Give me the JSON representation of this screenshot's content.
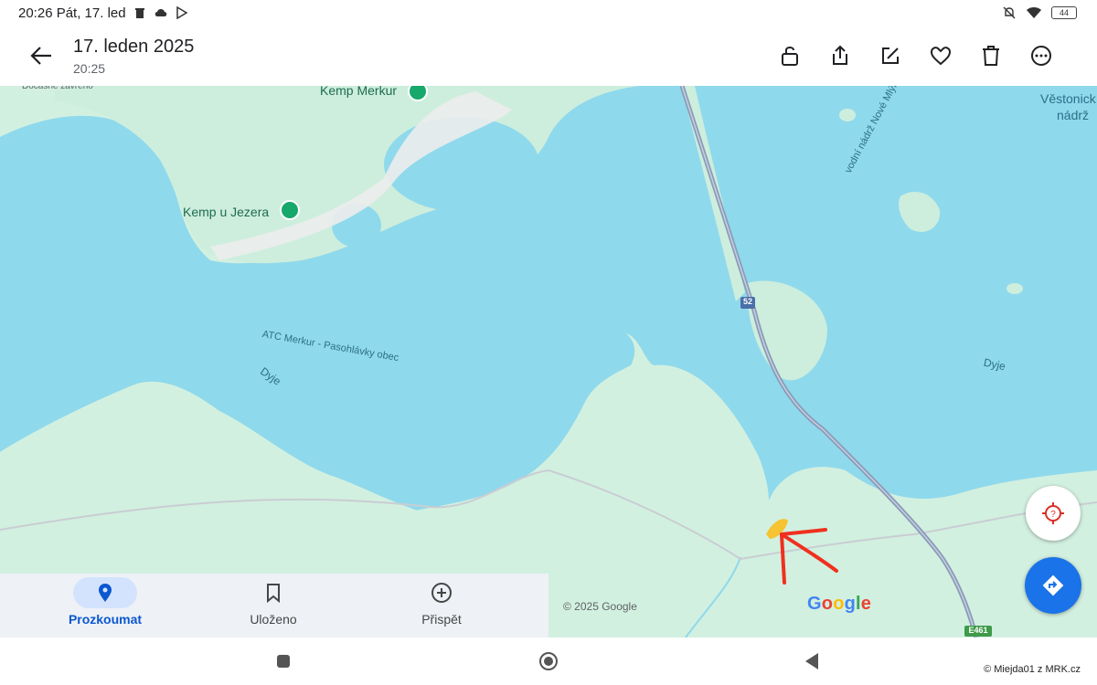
{
  "status": {
    "time": "20:26 Pát, 17. led",
    "battery": "44"
  },
  "header": {
    "title": "17. leden 2025",
    "subtitle": "20:25"
  },
  "map": {
    "labels": {
      "kemp_merkur": "Kemp Merkur",
      "kemp_u_jezera": "Kemp u Jezera",
      "atc_merkur": "ATC Merkur - Pasohlávky obec",
      "dyje_left": "Dyje",
      "dyje_right": "Dyje",
      "vodni_nadrz": "vodní nádrž Nové Mlýny",
      "vestonicka_1": "Věstonick",
      "vestonicka_2": "nádrž",
      "docasne_zavreno": "Dočasně zavřeno",
      "road_52": "52",
      "road_e461": "E461"
    },
    "copyright": "© 2025 Google",
    "google_logo": "Google"
  },
  "bottom_nav": {
    "explore": "Prozkoumat",
    "saved": "Uloženo",
    "contribute": "Přispět"
  },
  "watermark": "© Miejda01 z MRK.cz",
  "colors": {
    "water": "#8fd9ec",
    "land": "#cdeedd",
    "accent": "#1a73e8",
    "arrow": "#f0301e",
    "marker": "#f6c333"
  }
}
